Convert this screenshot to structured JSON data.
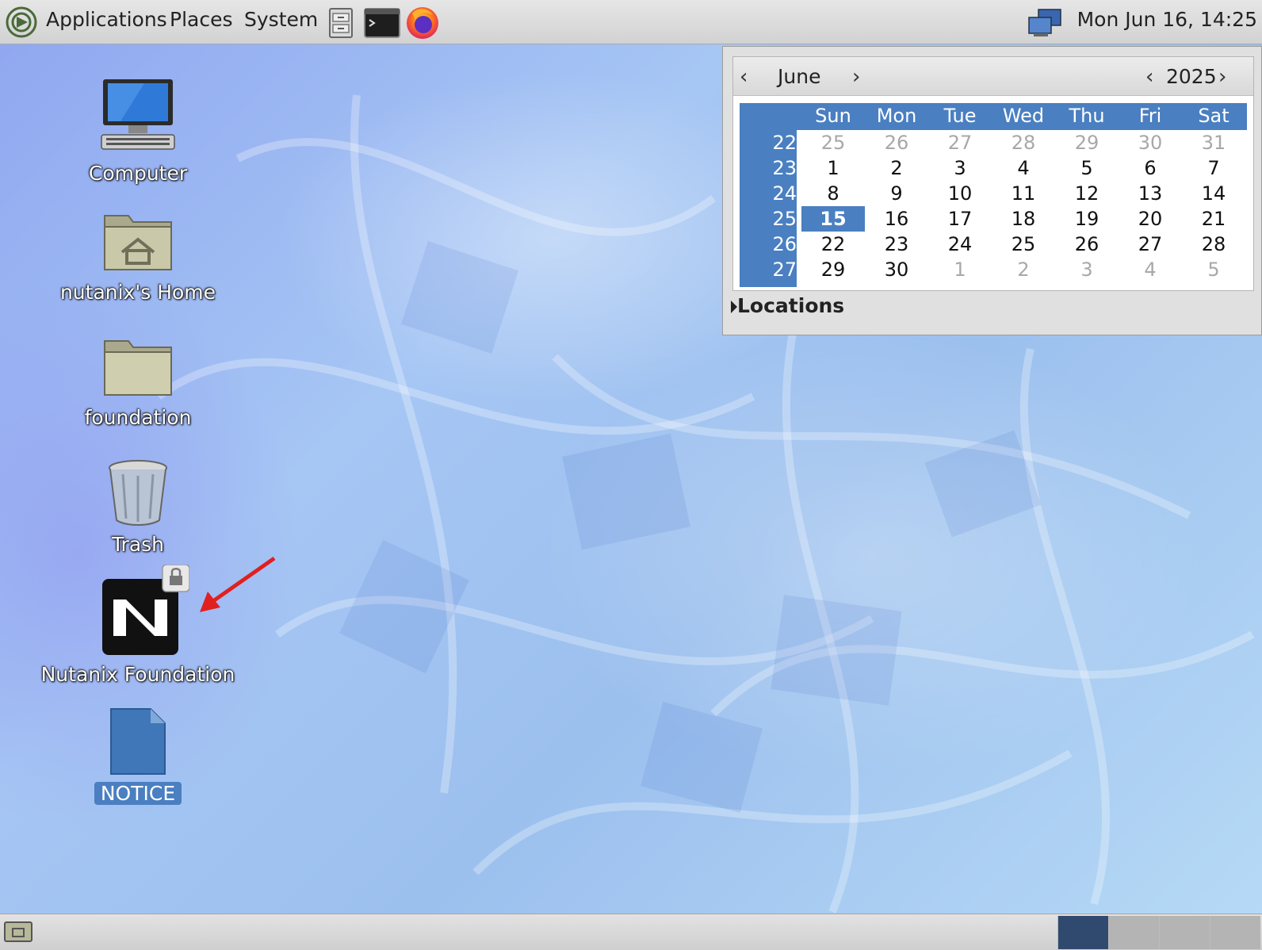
{
  "top_panel": {
    "menus": [
      "Applications",
      "Places",
      "System"
    ],
    "clock": "Mon Jun 16, 14:25"
  },
  "desktop_icons": [
    {
      "label": "Computer",
      "icon": "computer-icon"
    },
    {
      "label": "nutanix's Home",
      "icon": "home-folder-icon"
    },
    {
      "label": "foundation",
      "icon": "folder-icon"
    },
    {
      "label": "Trash",
      "icon": "trash-icon"
    },
    {
      "label": "Nutanix Foundation",
      "icon": "nutanix-app-icon"
    },
    {
      "label": "NOTICE",
      "icon": "document-icon"
    }
  ],
  "calendar": {
    "month": "June",
    "year": "2025",
    "weekdays": [
      "Sun",
      "Mon",
      "Tue",
      "Wed",
      "Thu",
      "Fri",
      "Sat"
    ],
    "weeks": [
      {
        "num": "22",
        "days": [
          "25",
          "26",
          "27",
          "28",
          "29",
          "30",
          "31"
        ]
      },
      {
        "num": "23",
        "days": [
          "1",
          "2",
          "3",
          "4",
          "5",
          "6",
          "7"
        ]
      },
      {
        "num": "24",
        "days": [
          "8",
          "9",
          "10",
          "11",
          "12",
          "13",
          "14"
        ]
      },
      {
        "num": "25",
        "days": [
          "15",
          "16",
          "17",
          "18",
          "19",
          "20",
          "21"
        ]
      },
      {
        "num": "26",
        "days": [
          "22",
          "23",
          "24",
          "25",
          "26",
          "27",
          "28"
        ]
      },
      {
        "num": "27",
        "days": [
          "29",
          "30",
          "1",
          "2",
          "3",
          "4",
          "5"
        ]
      }
    ],
    "today": "15",
    "locations_label": "Locations"
  }
}
